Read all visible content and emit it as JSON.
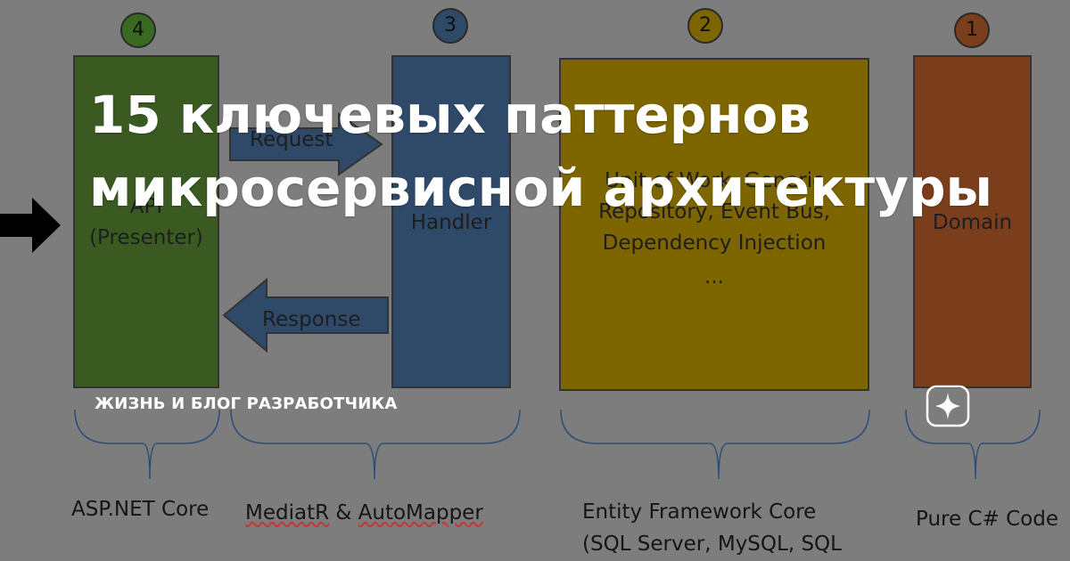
{
  "headline": {
    "line1": "15 ключевых паттернов",
    "line2": "микросервисной архитектуры"
  },
  "brand": "ЖИЗНЬ И БЛОГ РАЗРАБОТЧИКА",
  "layers": [
    {
      "badge": "4",
      "line1": "API",
      "line2": "(Presenter)",
      "color": "#3a5a22",
      "badge_color": "#3a6a22"
    },
    {
      "badge": "3",
      "line1": "Handler",
      "color": "#2e4a68",
      "badge_color": "#2e4a68"
    },
    {
      "badge": "2",
      "line1": "Unit of Work, Generic",
      "line2": "Repository, Event Bus,",
      "line3": "Dependency Injection",
      "line4": "...",
      "color": "#7d6500",
      "badge_color": "#7d6500"
    },
    {
      "badge": "1",
      "line1": "Domain",
      "color": "#7a3e1c",
      "badge_color": "#7a3e1c"
    }
  ],
  "arrows": {
    "request": "Request",
    "response": "Response"
  },
  "bottom": {
    "aspnet": "ASP.NET Core",
    "mediatr": "MediatR",
    "amp": "&",
    "automapper": "AutoMapper",
    "ef_line1": "Entity Framework Core",
    "ef_line2": "(SQL Server, MySQL, SQL",
    "pure": "Pure C# Code"
  },
  "icons": {
    "sparkle": "sparkle-icon",
    "input_arrow": "arrow-right-icon"
  }
}
